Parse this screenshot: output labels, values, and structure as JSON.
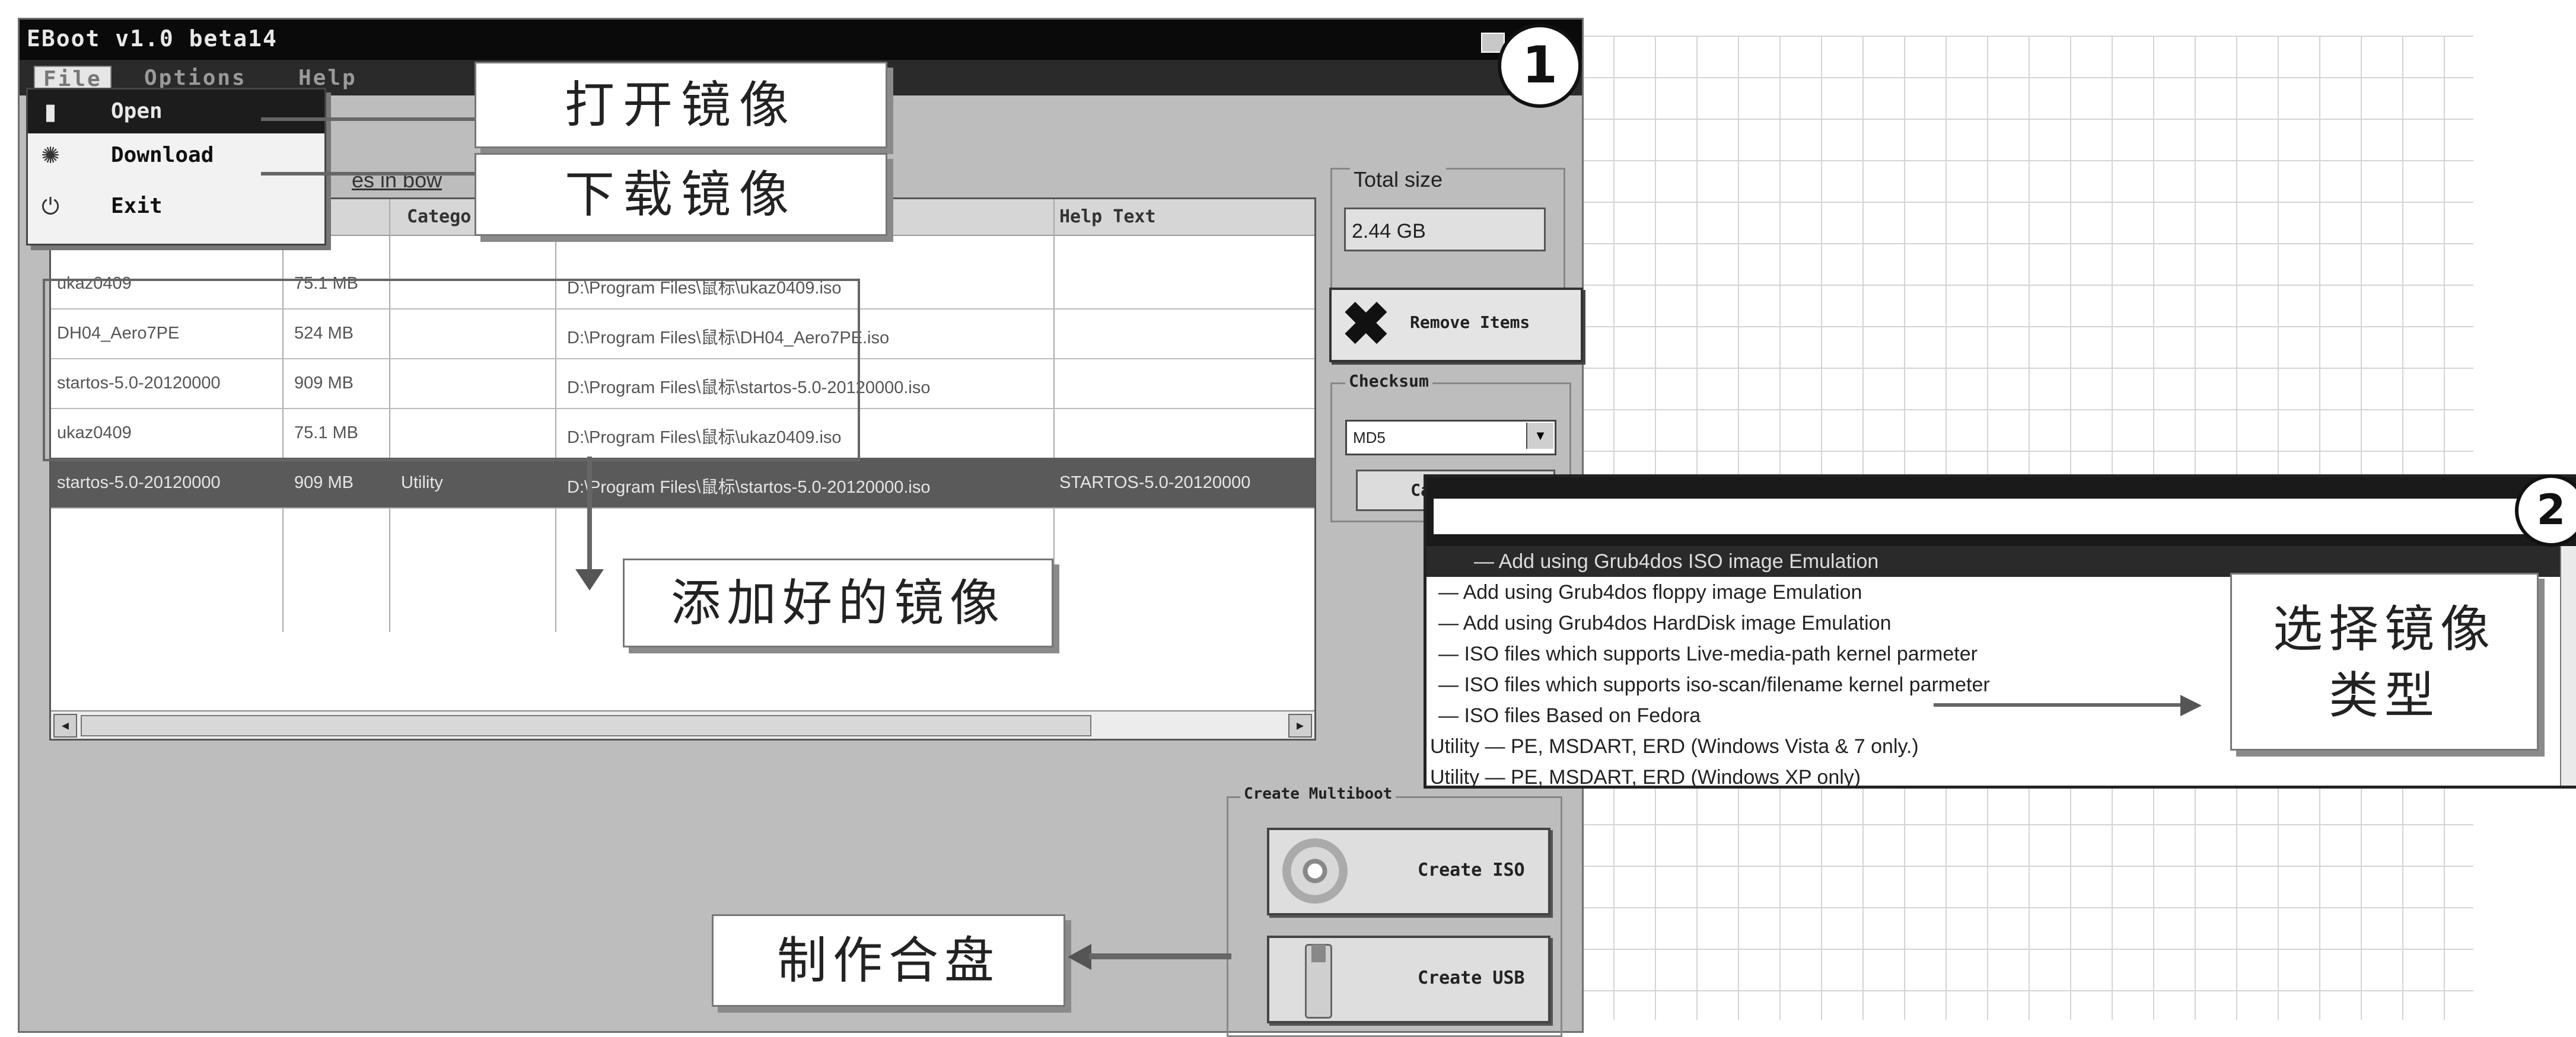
{
  "window": {
    "title": "EBoot v1.0 beta14"
  },
  "menubar": {
    "file": "File",
    "options": "Options",
    "help": "Help"
  },
  "file_menu": [
    {
      "label": "Open",
      "icon": "folder-icon"
    },
    {
      "label": "Download",
      "icon": "download-icon"
    },
    {
      "label": "Exit",
      "icon": "power-icon"
    }
  ],
  "browse_text": "es in bow",
  "table": {
    "headers": {
      "category": "Catego",
      "help": "Help Text"
    },
    "rows": [
      {
        "name": "ukaz0409",
        "size": "75.1 MB",
        "category": "",
        "path": "D:\\Program Files\\鼠标\\ukaz0409.iso",
        "help": ""
      },
      {
        "name": "DH04_Aero7PE",
        "size": "524 MB",
        "category": "",
        "path": "D:\\Program Files\\鼠标\\DH04_Aero7PE.iso",
        "help": ""
      },
      {
        "name": "startos-5.0-20120000",
        "size": "909 MB",
        "category": "",
        "path": "D:\\Program Files\\鼠标\\startos-5.0-20120000.iso",
        "help": ""
      },
      {
        "name": "ukaz0409",
        "size": "75.1 MB",
        "category": "",
        "path": "D:\\Program Files\\鼠标\\ukaz0409.iso",
        "help": ""
      },
      {
        "name": "startos-5.0-20120000",
        "size": "909 MB",
        "category": "Utility",
        "path": "D:\\Program Files\\鼠标\\startos-5.0-20120000.iso",
        "help": "STARTOS-5.0-20120000"
      }
    ]
  },
  "total_size": {
    "label": "Total size",
    "value": "2.44 GB"
  },
  "remove_button": "Remove Items",
  "checksum": {
    "label": "Checksum",
    "selected": "MD5",
    "calculate": "Calculate"
  },
  "create": {
    "label": "Create Multiboot",
    "iso": "Create ISO",
    "usb": "Create USB"
  },
  "callouts": {
    "open": "打开镜像",
    "download": "下载镜像",
    "added": "添加好的镜像",
    "make": "制作合盘",
    "type_line1": "选择镜像",
    "type_line2": "类型"
  },
  "steps": {
    "one": "1",
    "two": "2"
  },
  "popup_options": [
    "— Add using Grub4dos ISO image Emulation",
    "— Add using Grub4dos floppy image Emulation",
    "— Add using Grub4dos HardDisk image Emulation",
    "— ISO files which supports Live-media-path kernel parmeter",
    "— ISO files which supports iso-scan/filename kernel parmeter",
    "— ISO files Based on Fedora",
    "Utility — PE, MSDART, ERD (Windows Vista & 7 only.)",
    "Utility — PE, MSDART, ERD (Windows XP only)"
  ]
}
